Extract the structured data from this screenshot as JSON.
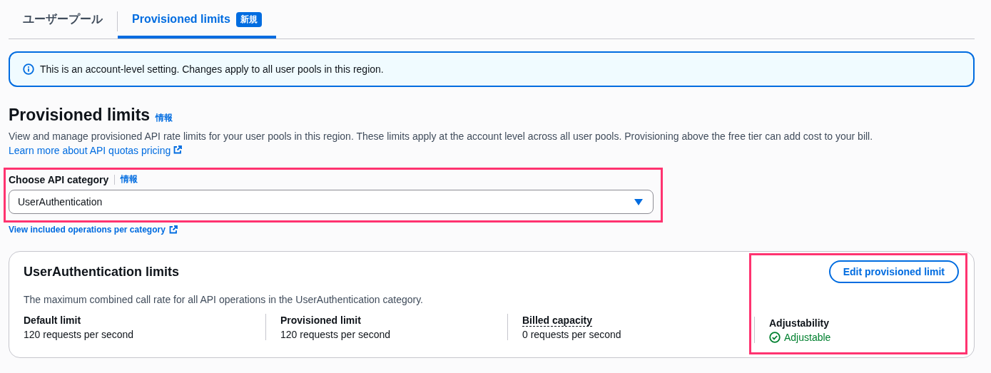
{
  "tabs": [
    {
      "label": "ユーザープール",
      "selected": false
    },
    {
      "label": "Provisioned limits",
      "selected": true,
      "badge": "新規"
    }
  ],
  "banner": {
    "kind": "info",
    "text": "This is an account-level setting. Changes apply to all user pools in this region."
  },
  "section": {
    "title": "Provisioned limits",
    "info_link": "情報",
    "description": "View and manage provisioned API rate limits for your user pools in this region. These limits apply at the account level across all user pools. Provisioning above the free tier can add cost to your bill.",
    "link": "Learn more about API quotas pricing"
  },
  "category_select": {
    "label": "Choose API category",
    "info_link": "情報",
    "value": "UserAuthentication",
    "help_link": "View included operations per category"
  },
  "limits_card": {
    "title": "UserAuthentication limits",
    "description": "The maximum combined call rate for all API operations in the UserAuthentication category.",
    "button": "Edit provisioned limit",
    "stats": [
      {
        "kind": "plain",
        "label": "Default limit",
        "value": "120 requests per second"
      },
      {
        "kind": "plain",
        "label": "Provisioned limit",
        "value": "120 requests per second"
      },
      {
        "kind": "popover",
        "label": "Billed capacity",
        "value": "0 requests per second"
      }
    ],
    "adjustability": {
      "label": "Adjustability",
      "kind": "success",
      "value": "Adjustable"
    }
  }
}
